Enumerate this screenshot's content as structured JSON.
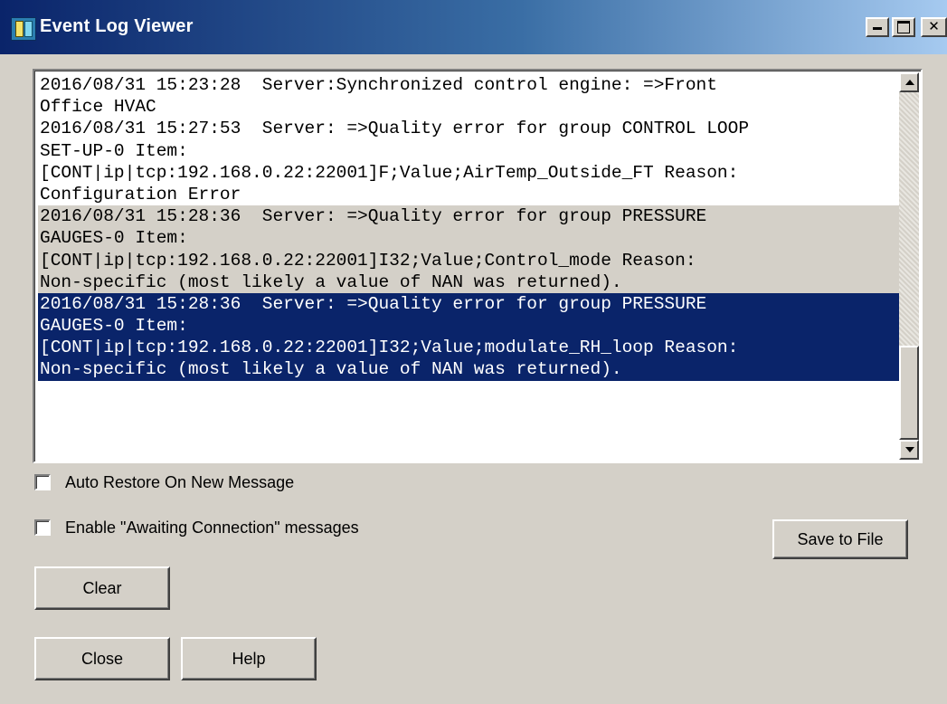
{
  "window": {
    "title": "Event Log Viewer"
  },
  "log": {
    "entries": [
      {
        "state": "white",
        "lines": [
          "2016/08/31 15:23:28  Server:Synchronized control engine: =>Front",
          "Office HVAC"
        ]
      },
      {
        "state": "white",
        "lines": [
          "2016/08/31 15:27:53  Server: =>Quality error for group CONTROL LOOP",
          "SET-UP-0 Item:",
          "[CONT|ip|tcp:192.168.0.22:22001]F;Value;AirTemp_Outside_FT Reason:",
          "Configuration Error"
        ]
      },
      {
        "state": "grey",
        "lines": [
          "2016/08/31 15:28:36  Server: =>Quality error for group PRESSURE",
          "GAUGES-0 Item:",
          "[CONT|ip|tcp:192.168.0.22:22001]I32;Value;Control_mode Reason:",
          "Non-specific (most likely a value of NAN was returned)."
        ]
      },
      {
        "state": "selected",
        "lines": [
          "2016/08/31 15:28:36  Server: =>Quality error for group PRESSURE",
          "GAUGES-0 Item:",
          "[CONT|ip|tcp:192.168.0.22:22001]I32;Value;modulate_RH_loop Reason:",
          "Non-specific (most likely a value of NAN was returned)."
        ]
      }
    ]
  },
  "options": {
    "auto_restore_label": "Auto Restore On New Message",
    "auto_restore_checked": false,
    "awaiting_label": "Enable \"Awaiting Connection\" messages",
    "awaiting_checked": false
  },
  "buttons": {
    "save": "Save to File",
    "clear": "Clear",
    "close": "Close",
    "help": "Help"
  },
  "colors": {
    "selection": "#0a246a",
    "face": "#d4d0c8"
  }
}
